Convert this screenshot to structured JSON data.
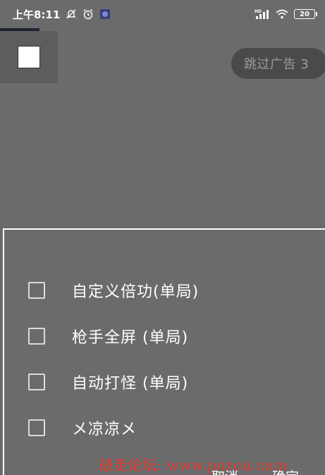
{
  "status_bar": {
    "time": "上午8:11",
    "icons": [
      "mute-bell-icon",
      "alarm-icon",
      "app-thumb-icon",
      "hd-signal-icon",
      "wifi-icon",
      "battery-icon"
    ],
    "signal_label": "HD",
    "battery_level": "20"
  },
  "skip_ad": {
    "label": "跳过广告 3"
  },
  "dialog": {
    "options": [
      {
        "label": "自定义倍功(单局)",
        "checked": false
      },
      {
        "label": "枪手全屏 (单局)",
        "checked": false
      },
      {
        "label": "自动打怪 (单局)",
        "checked": false
      },
      {
        "label": "メ凉凉メ",
        "checked": false
      }
    ],
    "cancel_label": "取消",
    "confirm_label": "确定"
  },
  "watermark": {
    "text": "破走论坛: www.pozou.com"
  },
  "colors": {
    "overlay": "#6b6b6b",
    "pill": "#4a4a4a",
    "watermark": "#e0392e"
  }
}
